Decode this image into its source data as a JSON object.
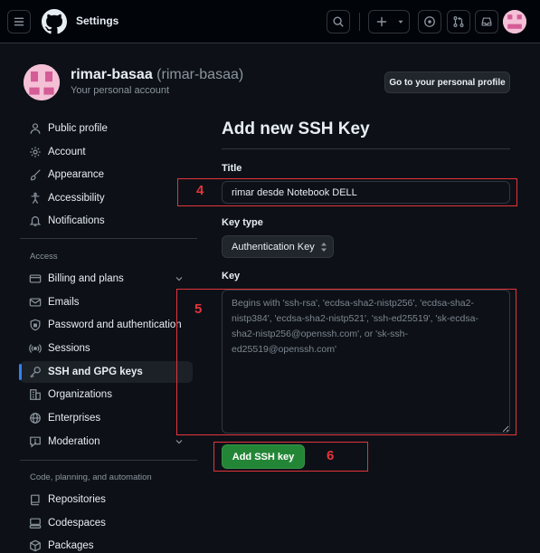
{
  "header": {
    "page_context": "Settings"
  },
  "profile": {
    "name": "rimar-basaa",
    "handle": "(rimar-basaa)",
    "subtitle": "Your personal account",
    "profile_button": "Go to your personal profile"
  },
  "sidebar": {
    "items_top": [
      {
        "label": "Public profile",
        "icon": "person-icon"
      },
      {
        "label": "Account",
        "icon": "gear-icon"
      },
      {
        "label": "Appearance",
        "icon": "paintbrush-icon"
      },
      {
        "label": "Accessibility",
        "icon": "accessibility-icon"
      },
      {
        "label": "Notifications",
        "icon": "bell-icon"
      }
    ],
    "access_heading": "Access",
    "items_access": [
      {
        "label": "Billing and plans",
        "icon": "credit-card-icon",
        "expandable": true
      },
      {
        "label": "Emails",
        "icon": "mail-icon"
      },
      {
        "label": "Password and authentication",
        "icon": "shield-lock-icon"
      },
      {
        "label": "Sessions",
        "icon": "broadcast-icon"
      },
      {
        "label": "SSH and GPG keys",
        "icon": "key-icon",
        "active": true
      },
      {
        "label": "Organizations",
        "icon": "organization-icon"
      },
      {
        "label": "Enterprises",
        "icon": "globe-icon"
      },
      {
        "label": "Moderation",
        "icon": "report-icon",
        "expandable": true
      }
    ],
    "code_heading": "Code, planning, and automation",
    "items_code": [
      {
        "label": "Repositories",
        "icon": "repo-icon"
      },
      {
        "label": "Codespaces",
        "icon": "codespaces-icon"
      },
      {
        "label": "Packages",
        "icon": "package-icon"
      }
    ]
  },
  "form": {
    "heading": "Add new SSH Key",
    "title_label": "Title",
    "title_value": "rimar desde Notebook DELL",
    "key_type_label": "Key type",
    "key_type_value": "Authentication Key",
    "key_label": "Key",
    "key_placeholder": "Begins with 'ssh-rsa', 'ecdsa-sha2-nistp256', 'ecdsa-sha2-nistp384', 'ecdsa-sha2-nistp521', 'ssh-ed25519', 'sk-ecdsa-sha2-nistp256@openssh.com', or 'sk-ssh-ed25519@openssh.com'",
    "submit_label": "Add SSH key"
  },
  "annotations": {
    "step_title": "4",
    "step_key": "5",
    "step_submit": "6",
    "color": "#e5333b"
  },
  "colors": {
    "accent_blue": "#2f81f7",
    "primary_green": "#238636",
    "background": "#0d1117"
  }
}
